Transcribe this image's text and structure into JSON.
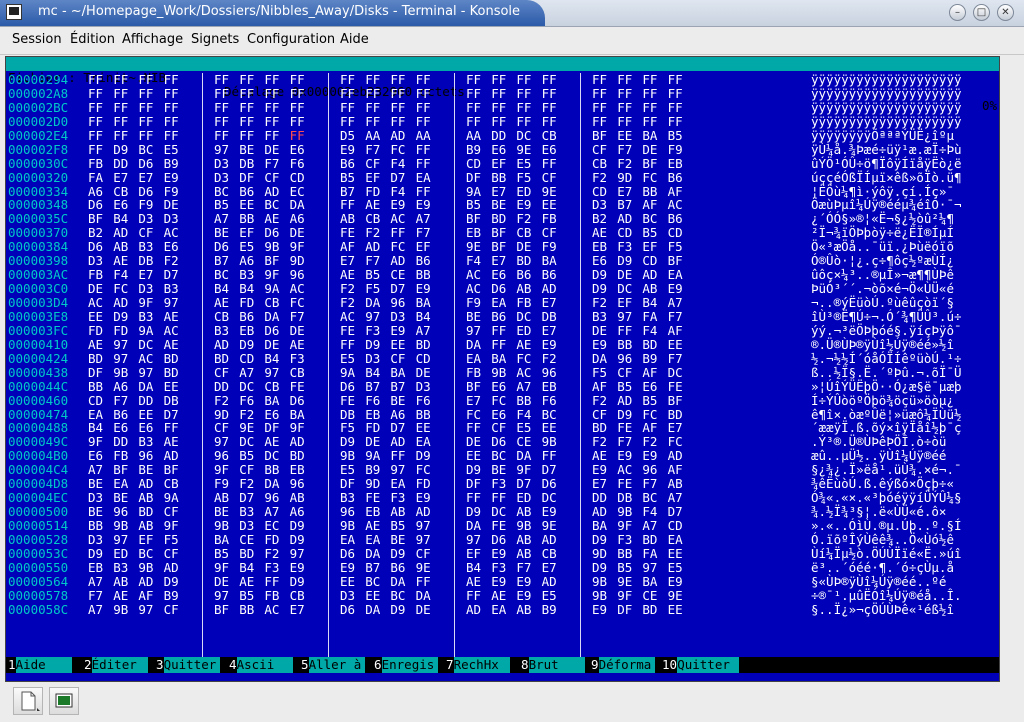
{
  "window": {
    "title": "mc - ~/Homepage_Work/Dossiers/Nibbles_Away/Disks - Terminal - Konsole",
    "buttons": {
      "minimize": "–",
      "maximize": "□",
      "close": "✕"
    }
  },
  "menu": [
    "Session",
    "Édition",
    "Affichage",
    "Signets",
    "Configuration",
    "Aide"
  ],
  "status": {
    "file_label": "Fichier : Trinit~.NIB",
    "offset_label": "Décalage 0x000002eb232960 octets",
    "percent": "0%"
  },
  "hex_rows": [
    {
      "addr": "00000294",
      "bytes": [
        "FF",
        "FF",
        "FF",
        "FF",
        "FF",
        "FF",
        "FF",
        "FF",
        "FF",
        "FF",
        "FF",
        "FF",
        "FF",
        "FF",
        "FF",
        "FF",
        "FF",
        "FF",
        "FF",
        "FF"
      ],
      "ascii": "ÿÿÿÿÿÿÿÿÿÿÿÿÿÿÿÿÿÿÿÿ"
    },
    {
      "addr": "000002A8",
      "bytes": [
        "FF",
        "FF",
        "FF",
        "FF",
        "FF",
        "FF",
        "FF",
        "FF",
        "FF",
        "FF",
        "FF",
        "FF",
        "FF",
        "FF",
        "FF",
        "FF",
        "FF",
        "FF",
        "FF",
        "FF"
      ],
      "ascii": "ÿÿÿÿÿÿÿÿÿÿÿÿÿÿÿÿÿÿÿÿ"
    },
    {
      "addr": "000002BC",
      "bytes": [
        "FF",
        "FF",
        "FF",
        "FF",
        "FF",
        "FF",
        "FF",
        "FF",
        "FF",
        "FF",
        "FF",
        "FF",
        "FF",
        "FF",
        "FF",
        "FF",
        "FF",
        "FF",
        "FF",
        "FF"
      ],
      "ascii": "ÿÿÿÿÿÿÿÿÿÿÿÿÿÿÿÿÿÿÿÿ"
    },
    {
      "addr": "000002D0",
      "bytes": [
        "FF",
        "FF",
        "FF",
        "FF",
        "FF",
        "FF",
        "FF",
        "FF",
        "FF",
        "FF",
        "FF",
        "FF",
        "FF",
        "FF",
        "FF",
        "FF",
        "FF",
        "FF",
        "FF",
        "FF"
      ],
      "ascii": "ÿÿÿÿÿÿÿÿÿÿÿÿÿÿÿÿÿÿÿÿ"
    },
    {
      "addr": "000002E4",
      "bytes": [
        "FF",
        "FF",
        "FF",
        "FF",
        "FF",
        "FF",
        "FF",
        "FF",
        "D5",
        "AA",
        "AD",
        "AA",
        "AA",
        "DD",
        "DC",
        "CB",
        "BF",
        "EE",
        "BA",
        "B5"
      ],
      "ascii": "ÿÿÿÿÿÿÿÿÕª­ªªÝÜË¿îºµ",
      "sel": [
        6,
        8
      ]
    },
    {
      "addr": "000002F8",
      "bytes": [
        "FF",
        "D9",
        "BC",
        "E5",
        "97",
        "BE",
        "DE",
        "E6",
        "E9",
        "F7",
        "FC",
        "FF",
        "B9",
        "E6",
        "9E",
        "E6",
        "CF",
        "F7",
        "DE",
        "F9"
      ],
      "ascii": "ÿÙ¼å.¾Þæé÷üÿ¹æ.æÏ÷Þù"
    },
    {
      "addr": "0000030C",
      "bytes": [
        "FB",
        "DD",
        "D6",
        "B9",
        "D3",
        "DB",
        "F7",
        "F6",
        "B6",
        "CF",
        "F4",
        "FF",
        "CD",
        "EF",
        "E5",
        "FF",
        "CB",
        "F2",
        "BF",
        "EB"
      ],
      "ascii": "ûÝÖ¹ÓÛ÷ö¶ÏôÿÍïåÿËò¿ë"
    },
    {
      "addr": "00000320",
      "bytes": [
        "FA",
        "E7",
        "E7",
        "E9",
        "D3",
        "DF",
        "CF",
        "CD",
        "B5",
        "EF",
        "D7",
        "EA",
        "DF",
        "BB",
        "F5",
        "CF",
        "F2",
        "9D",
        "FC",
        "B6"
      ],
      "ascii": "úççéÓßÏÍµï×êß»õÏò.ü¶"
    },
    {
      "addr": "00000334",
      "bytes": [
        "A6",
        "CB",
        "D6",
        "F9",
        "BC",
        "B6",
        "AD",
        "EC",
        "B7",
        "FD",
        "F4",
        "FF",
        "9A",
        "E7",
        "ED",
        "9E",
        "CD",
        "E7",
        "BB",
        "AF"
      ],
      "ascii": "¦ËÖù¼¶­ì·ýôÿ.çí.Íç»¯"
    },
    {
      "addr": "00000348",
      "bytes": [
        "D6",
        "E6",
        "F9",
        "DE",
        "B5",
        "EE",
        "BC",
        "DA",
        "FF",
        "AE",
        "E9",
        "E9",
        "B5",
        "BE",
        "E9",
        "EE",
        "D3",
        "B7",
        "AF",
        "AC"
      ],
      "ascii": "ÖæùÞµî¼Úÿ®ééµ¾éîÓ·¯¬"
    },
    {
      "addr": "0000035C",
      "bytes": [
        "BF",
        "B4",
        "D3",
        "D3",
        "A7",
        "BB",
        "AE",
        "A6",
        "AB",
        "CB",
        "AC",
        "A7",
        "BF",
        "BD",
        "F2",
        "FB",
        "B2",
        "AD",
        "BC",
        "B6"
      ],
      "ascii": "¿´ÓÓ§»®¦«Ë¬§¿½òû²­¼¶"
    },
    {
      "addr": "00000370",
      "bytes": [
        "B2",
        "AD",
        "CF",
        "AC",
        "BE",
        "EF",
        "D6",
        "DE",
        "FE",
        "F2",
        "FF",
        "F7",
        "EB",
        "BF",
        "CB",
        "CF",
        "AE",
        "CD",
        "B5",
        "CD"
      ],
      "ascii": "²­Ï¬¾ïÖÞþòÿ÷ë¿ËÏ®ÍµÍ"
    },
    {
      "addr": "00000384",
      "bytes": [
        "D6",
        "AB",
        "B3",
        "E6",
        "D6",
        "E5",
        "9B",
        "9F",
        "AF",
        "AD",
        "FC",
        "EF",
        "9E",
        "BF",
        "DE",
        "F9",
        "EB",
        "F3",
        "EF",
        "F5"
      ],
      "ascii": "Ö«³æÖå..¯­üï.¿Þùëóïõ"
    },
    {
      "addr": "00000398",
      "bytes": [
        "D3",
        "AE",
        "DB",
        "F2",
        "B7",
        "A6",
        "BF",
        "9D",
        "E7",
        "F7",
        "AD",
        "B6",
        "F4",
        "E7",
        "BD",
        "BA",
        "E6",
        "D9",
        "CD",
        "BF"
      ],
      "ascii": "Ó®Ûò·¦¿.ç÷­¶ôç½ºæÙÍ¿"
    },
    {
      "addr": "000003AC",
      "bytes": [
        "FB",
        "F4",
        "E7",
        "D7",
        "BC",
        "B3",
        "9F",
        "96",
        "AE",
        "B5",
        "CE",
        "BB",
        "AC",
        "E6",
        "B6",
        "B6",
        "D9",
        "DE",
        "AD",
        "EA"
      ],
      "ascii": "ûôç×¼³..®µÎ»¬æ¶¶ÙÞ­ê"
    },
    {
      "addr": "000003C0",
      "bytes": [
        "DE",
        "FC",
        "D3",
        "B3",
        "B4",
        "B4",
        "9A",
        "AC",
        "F2",
        "F5",
        "D7",
        "E9",
        "AC",
        "D6",
        "AB",
        "AD",
        "D9",
        "DC",
        "AB",
        "E9"
      ],
      "ascii": "ÞüÓ³´´.¬òõ×é¬Ö«­ÙÜ«é"
    },
    {
      "addr": "000003D4",
      "bytes": [
        "AC",
        "AD",
        "9F",
        "97",
        "AE",
        "FD",
        "CB",
        "FC",
        "F2",
        "DA",
        "96",
        "BA",
        "F9",
        "EA",
        "FB",
        "E7",
        "F2",
        "EF",
        "B4",
        "A7"
      ],
      "ascii": "¬­..®ýËüòÚ.ºùêûçòï´§"
    },
    {
      "addr": "000003E8",
      "bytes": [
        "EE",
        "D9",
        "B3",
        "AE",
        "CB",
        "B6",
        "DA",
        "F7",
        "AC",
        "97",
        "D3",
        "B4",
        "BE",
        "B6",
        "DC",
        "DB",
        "B3",
        "97",
        "FA",
        "F7"
      ],
      "ascii": "îÙ³®Ë¶Ú÷¬.Ó´¾¶ÜÛ³.ú÷"
    },
    {
      "addr": "000003FC",
      "bytes": [
        "FD",
        "FD",
        "9A",
        "AC",
        "B3",
        "EB",
        "D6",
        "DE",
        "FE",
        "F3",
        "E9",
        "A7",
        "97",
        "FF",
        "ED",
        "E7",
        "DE",
        "FF",
        "F4",
        "AF"
      ],
      "ascii": "ýý.¬³ëÖÞþóé§.ÿíçÞÿô¯"
    },
    {
      "addr": "00000410",
      "bytes": [
        "AE",
        "97",
        "DC",
        "AE",
        "AD",
        "D9",
        "DE",
        "AE",
        "FF",
        "D9",
        "EE",
        "BD",
        "DA",
        "FF",
        "AE",
        "E9",
        "E9",
        "BB",
        "BD",
        "EE"
      ],
      "ascii": "®.Ü®­ÙÞ®ÿÙî½Úÿ®éé»½î"
    },
    {
      "addr": "00000424",
      "bytes": [
        "BD",
        "97",
        "AC",
        "BD",
        "BD",
        "CD",
        "B4",
        "F3",
        "E5",
        "D3",
        "CF",
        "CD",
        "EA",
        "BA",
        "FC",
        "F2",
        "DA",
        "96",
        "B9",
        "F7"
      ],
      "ascii": "½.¬½½Í´óåÓÏÍêºüòÚ.¹÷"
    },
    {
      "addr": "00000438",
      "bytes": [
        "DF",
        "9B",
        "97",
        "BD",
        "CF",
        "A7",
        "97",
        "CB",
        "9A",
        "B4",
        "BA",
        "DE",
        "FB",
        "9B",
        "AC",
        "96",
        "F5",
        "CF",
        "AF",
        "DC"
      ],
      "ascii": "ß..½Ï§.Ë.´ºÞû.¬.õÏ¯Ü"
    },
    {
      "addr": "0000044C",
      "bytes": [
        "BB",
        "A6",
        "DA",
        "EE",
        "DD",
        "DC",
        "CB",
        "FE",
        "D6",
        "B7",
        "B7",
        "D3",
        "BF",
        "E6",
        "A7",
        "EB",
        "AF",
        "B5",
        "E6",
        "FE"
      ],
      "ascii": "»¦ÚîÝÜËþÖ··Ó¿æ§ë¯µæþ"
    },
    {
      "addr": "00000460",
      "bytes": [
        "CD",
        "F7",
        "DD",
        "DB",
        "F2",
        "F6",
        "BA",
        "D6",
        "FE",
        "F6",
        "BE",
        "F6",
        "E7",
        "FC",
        "BB",
        "F6",
        "F2",
        "AD",
        "B5",
        "BF"
      ],
      "ascii": "Í÷ÝÛòöºÖþö¾öçü»öò­µ¿"
    },
    {
      "addr": "00000474",
      "bytes": [
        "EA",
        "B6",
        "EE",
        "D7",
        "9D",
        "F2",
        "E6",
        "BA",
        "DB",
        "EB",
        "A6",
        "BB",
        "FC",
        "E6",
        "F4",
        "BC",
        "CF",
        "D9",
        "FC",
        "BD"
      ],
      "ascii": "ê¶î×.òæºÛë¦»üæô¼ÏÙü½"
    },
    {
      "addr": "00000488",
      "bytes": [
        "B4",
        "E6",
        "E6",
        "FF",
        "CF",
        "9E",
        "DF",
        "9F",
        "F5",
        "FD",
        "D7",
        "EE",
        "FF",
        "CF",
        "E5",
        "EE",
        "BD",
        "FE",
        "AF",
        "E7"
      ],
      "ascii": "´ææÿÏ.ß.õý×îÿÏåî½þ¯ç"
    },
    {
      "addr": "0000049C",
      "bytes": [
        "9F",
        "DD",
        "B3",
        "AE",
        "97",
        "DC",
        "AE",
        "AD",
        "D9",
        "DE",
        "AD",
        "EA",
        "DE",
        "D6",
        "CE",
        "9B",
        "F2",
        "F7",
        "F2",
        "FC"
      ],
      "ascii": ".Ý³®.Ü®­ÙÞ­êÞÖÎ.ò÷òü"
    },
    {
      "addr": "000004B0",
      "bytes": [
        "E6",
        "FB",
        "96",
        "AD",
        "96",
        "B5",
        "DC",
        "BD",
        "9B",
        "9A",
        "FF",
        "D9",
        "EE",
        "BC",
        "DA",
        "FF",
        "AE",
        "E9",
        "E9",
        "AD"
      ],
      "ascii": "æû.­.µÜ½..ÿÙî¼Úÿ®éé­"
    },
    {
      "addr": "000004C4",
      "bytes": [
        "A7",
        "BF",
        "BE",
        "BF",
        "9F",
        "CF",
        "BB",
        "EB",
        "E5",
        "B9",
        "97",
        "FC",
        "D9",
        "BE",
        "9F",
        "D7",
        "E9",
        "AC",
        "96",
        "AF"
      ],
      "ascii": "§¿¾¿.Ï»ëå¹.üÙ¾.×é¬.¯"
    },
    {
      "addr": "000004D8",
      "bytes": [
        "BE",
        "EA",
        "AD",
        "CB",
        "F9",
        "F2",
        "DA",
        "96",
        "DF",
        "9D",
        "EA",
        "FD",
        "DF",
        "F3",
        "D7",
        "D6",
        "E7",
        "FE",
        "F7",
        "AB"
      ],
      "ascii": "¾ê­ËùòÚ.ß.êýßó×Öçþ÷«"
    },
    {
      "addr": "000004EC",
      "bytes": [
        "D3",
        "BE",
        "AB",
        "9A",
        "AB",
        "D7",
        "96",
        "AB",
        "B3",
        "FE",
        "F3",
        "E9",
        "FF",
        "FF",
        "ED",
        "DC",
        "DD",
        "DB",
        "BC",
        "A7"
      ],
      "ascii": "Ó¾«.«×.«³þóéÿÿíÜÝÛ¼§"
    },
    {
      "addr": "00000500",
      "bytes": [
        "BE",
        "96",
        "BD",
        "CF",
        "BE",
        "B3",
        "A7",
        "A6",
        "96",
        "EB",
        "AB",
        "AD",
        "D9",
        "DC",
        "AB",
        "E9",
        "AD",
        "9B",
        "F4",
        "D7"
      ],
      "ascii": "¾.½Ï¾³§¦.ë«­ÙÜ«é­.ô×"
    },
    {
      "addr": "00000514",
      "bytes": [
        "BB",
        "9B",
        "AB",
        "9F",
        "9B",
        "D3",
        "EC",
        "D9",
        "9B",
        "AE",
        "B5",
        "97",
        "DA",
        "FE",
        "9B",
        "9E",
        "BA",
        "9F",
        "A7",
        "CD"
      ],
      "ascii": "».«..ÓìÙ.®µ.Úþ..º.§Í"
    },
    {
      "addr": "00000528",
      "bytes": [
        "D3",
        "97",
        "EF",
        "F5",
        "BA",
        "CE",
        "FD",
        "D9",
        "EA",
        "EA",
        "BE",
        "97",
        "97",
        "D6",
        "AB",
        "AD",
        "D9",
        "F3",
        "BD",
        "EA"
      ],
      "ascii": "Ó.ïõºÎýÙêê¾..Ö«­Ùó½ê"
    },
    {
      "addr": "0000053C",
      "bytes": [
        "D9",
        "ED",
        "BC",
        "CF",
        "B5",
        "BD",
        "F2",
        "97",
        "D6",
        "DA",
        "D9",
        "CF",
        "EF",
        "E9",
        "AB",
        "CB",
        "9D",
        "BB",
        "FA",
        "EE"
      ],
      "ascii": "Ùí¼Ïµ½ò.ÖÚÙÏïé«Ë.»úî"
    },
    {
      "addr": "00000550",
      "bytes": [
        "EB",
        "B3",
        "9B",
        "AD",
        "9F",
        "B4",
        "F3",
        "E9",
        "E9",
        "B7",
        "B6",
        "9E",
        "B4",
        "F3",
        "F7",
        "E7",
        "D9",
        "B5",
        "97",
        "E5"
      ],
      "ascii": "ë³.­.´óéé·¶.´ó÷çÙµ.å"
    },
    {
      "addr": "00000564",
      "bytes": [
        "A7",
        "AB",
        "AD",
        "D9",
        "DE",
        "AE",
        "FF",
        "D9",
        "EE",
        "BC",
        "DA",
        "FF",
        "AE",
        "E9",
        "E9",
        "AD",
        "9B",
        "9E",
        "BA",
        "E9"
      ],
      "ascii": "§«­ÙÞ®ÿÙî¼Úÿ®éé­..ºé"
    },
    {
      "addr": "00000578",
      "bytes": [
        "F7",
        "AE",
        "AF",
        "B9",
        "97",
        "B5",
        "FB",
        "CB",
        "D3",
        "EE",
        "BC",
        "DA",
        "FF",
        "AE",
        "E9",
        "E5",
        "9B",
        "9F",
        "CE",
        "9E"
      ],
      "ascii": "÷®¯¹.µûËÓî¼Úÿ®éå..Î."
    },
    {
      "addr": "0000058C",
      "bytes": [
        "A7",
        "9B",
        "97",
        "CF",
        "BF",
        "BB",
        "AC",
        "E7",
        "D6",
        "DA",
        "D9",
        "DE",
        "AD",
        "EA",
        "AB",
        "B9",
        "E9",
        "DF",
        "BD",
        "EE"
      ],
      "ascii": "§..Ï¿»¬çÖÚÙÞ­ê«¹éß½î"
    }
  ],
  "highlight": {
    "row": 4,
    "col": 7
  },
  "fn_keys": [
    {
      "num": "1",
      "label": "Aide"
    },
    {
      "num": "2",
      "label": "Éditer"
    },
    {
      "num": "3",
      "label": "Quitter"
    },
    {
      "num": "4",
      "label": "Ascii"
    },
    {
      "num": "5",
      "label": "Aller à"
    },
    {
      "num": "6",
      "label": "Enregis"
    },
    {
      "num": "7",
      "label": "RechHx"
    },
    {
      "num": "8",
      "label": "Brut"
    },
    {
      "num": "9",
      "label": "Déforma"
    },
    {
      "num": "10",
      "label": "Quitter"
    }
  ],
  "toolbar": {
    "new_session_icon": "new-session-icon",
    "terminal_icon": "terminal-icon"
  }
}
